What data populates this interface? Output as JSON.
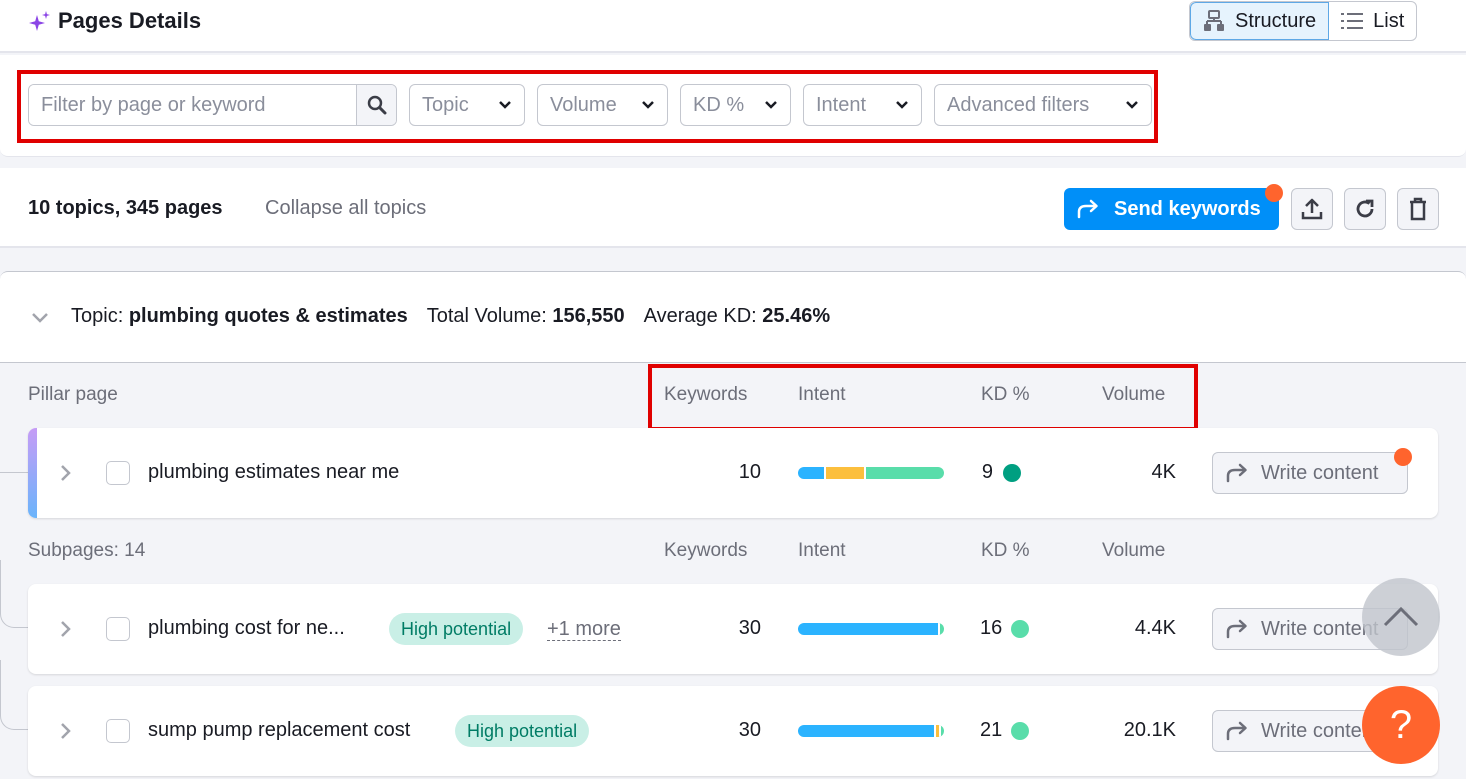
{
  "header": {
    "title": "Pages Details",
    "view_toggle": [
      {
        "label": "Structure",
        "icon": "sitemap-icon",
        "active": true
      },
      {
        "label": "List",
        "icon": "list-icon",
        "active": false
      }
    ]
  },
  "filters": {
    "search_placeholder": "Filter by page or keyword",
    "search_value": "",
    "dropdowns": [
      "Topic",
      "Volume",
      "KD %",
      "Intent",
      "Advanced filters"
    ]
  },
  "summary": {
    "count_text": "10 topics, 345 pages",
    "collapse_label": "Collapse all topics",
    "send_keywords_label": "Send keywords",
    "actions": [
      "export-icon",
      "refresh-icon",
      "trash-icon"
    ]
  },
  "topic": {
    "prefix": "Topic: ",
    "name": "plumbing quotes & estimates",
    "total_volume_label": "Total Volume: ",
    "total_volume": "156,550",
    "avg_kd_label": "Average KD: ",
    "avg_kd": "25.46%"
  },
  "columns": {
    "pillar_label": "Pillar page",
    "subpages_label": "Subpages: 14",
    "keywords": "Keywords",
    "intent": "Intent",
    "kd": "KD %",
    "volume": "Volume"
  },
  "colors": {
    "intent_informational": "#2bb3ff",
    "intent_navigational": "#fcbf3d",
    "intent_commercial": "#59ddaa",
    "kd_very_easy": "#009f81",
    "kd_easy": "#59ddaa",
    "accent": "#008ff8",
    "notification": "#ff642d"
  },
  "pillar": {
    "name": "plumbing estimates near me",
    "keywords": "10",
    "intent": [
      {
        "type": "informational",
        "share": 0.18
      },
      {
        "type": "navigational",
        "share": 0.27
      },
      {
        "type": "commercial",
        "share": 0.55
      }
    ],
    "kd": "9",
    "kd_level": "very_easy",
    "volume": "4K",
    "write_label": "Write content"
  },
  "subpages": [
    {
      "name": "plumbing cost for ne...",
      "badge": "High potential",
      "more": "+1 more",
      "keywords": "30",
      "intent": [
        {
          "type": "informational",
          "share": 0.96
        },
        {
          "type": "commercial",
          "share": 0.04
        }
      ],
      "kd": "16",
      "kd_level": "easy",
      "volume": "4.4K",
      "write_label": "Write content"
    },
    {
      "name": "sump pump replacement cost",
      "badge": "High potential",
      "more": "",
      "keywords": "30",
      "intent": [
        {
          "type": "informational",
          "share": 0.93
        },
        {
          "type": "navigational",
          "share": 0.035
        },
        {
          "type": "commercial",
          "share": 0.035
        }
      ],
      "kd": "21",
      "kd_level": "easy",
      "volume": "20.1K",
      "write_label": "Write content"
    }
  ],
  "floating": {
    "help_label": "?"
  }
}
